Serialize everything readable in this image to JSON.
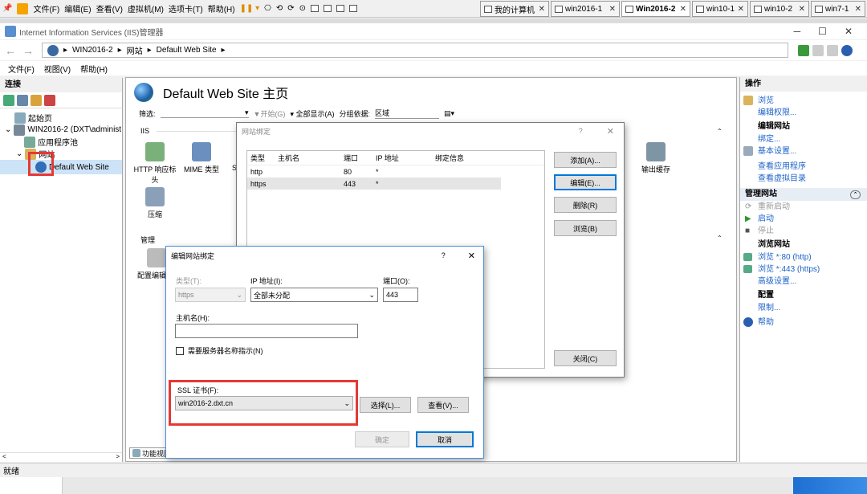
{
  "vm_toolbar": {
    "menus": [
      "文件(F)",
      "编辑(E)",
      "查看(V)",
      "虚拟机(M)",
      "选项卡(T)",
      "帮助(H)"
    ],
    "tabs": [
      "我的计算机",
      "win2016-1",
      "Win2016-2",
      "win10-1",
      "win10-2",
      "win7-1"
    ],
    "active_tab": "Win2016-2"
  },
  "window": {
    "title": "Internet Information Services (IIS)管理器",
    "breadcrumb": [
      "WIN2016-2",
      "网站",
      "Default Web Site"
    ],
    "menu": [
      "文件(F)",
      "视图(V)",
      "帮助(H)"
    ]
  },
  "connections": {
    "header": "连接",
    "tree": [
      "起始页",
      "WIN2016-2 (DXT\\administ",
      "应用程序池",
      "网站",
      "Default Web Site"
    ]
  },
  "center": {
    "title": "Default Web Site 主页",
    "filter_label": "筛选:",
    "start_label": "开始(G)",
    "show_all_label": "全部显示(A)",
    "group_by_label": "分组依据:",
    "group_by_value": "区域",
    "group_iis": "IIS",
    "group_manage": "管理",
    "features": [
      "HTTP 响应标头",
      "MIME 类型",
      "S",
      "压缩",
      "输出缓存"
    ],
    "manage_features": [
      "配置编辑"
    ],
    "bottom_tab": "功能视图"
  },
  "bindings_dialog": {
    "title": "网站绑定",
    "help": "?",
    "columns": [
      "类型",
      "主机名",
      "端口",
      "IP 地址",
      "绑定信息"
    ],
    "rows": [
      {
        "type": "http",
        "host": "",
        "port": "80",
        "ip": "*",
        "info": ""
      },
      {
        "type": "https",
        "host": "",
        "port": "443",
        "ip": "*",
        "info": ""
      }
    ],
    "buttons": [
      "添加(A)...",
      "编辑(E)...",
      "删除(R)",
      "浏览(B)"
    ],
    "close": "关闭(C)"
  },
  "edit_dialog": {
    "title": "编辑网站绑定",
    "help": "?",
    "type_label": "类型(T):",
    "type_value": "https",
    "ip_label": "IP 地址(I):",
    "ip_value": "全部未分配",
    "port_label": "端口(O):",
    "port_value": "443",
    "host_label": "主机名(H):",
    "host_value": "",
    "sni_label": "需要服务器名称指示(N)",
    "ssl_label": "SSL 证书(F):",
    "ssl_value": "win2016-2.dxt.cn",
    "select_button": "选择(L)...",
    "view_button": "查看(V)...",
    "ok_button": "确定",
    "cancel_button": "取消"
  },
  "actions": {
    "header": "操作",
    "browse": "浏览",
    "edit_perms": "编辑权限...",
    "edit_site_title": "编辑网站",
    "bindings": "绑定...",
    "basic_settings": "基本设置...",
    "view_apps": "查看应用程序",
    "view_vdirs": "查看虚拟目录",
    "manage_header": "管理网站",
    "restart": "重新启动",
    "start": "启动",
    "stop": "停止",
    "browse_site_title": "浏览网站",
    "browse_http": "浏览 *:80 (http)",
    "browse_https": "浏览 *:443 (https)",
    "advanced": "高级设置...",
    "config_title": "配置",
    "limits": "限制...",
    "help": "帮助"
  },
  "status": {
    "text": "就绪"
  }
}
